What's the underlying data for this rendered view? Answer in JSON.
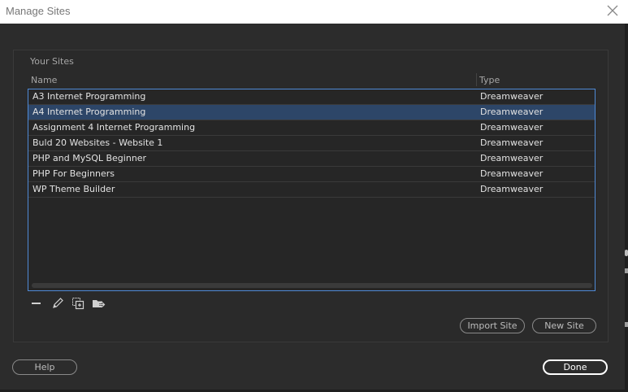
{
  "window": {
    "title": "Manage Sites"
  },
  "panel": {
    "section_label": "Your Sites",
    "columns": {
      "name": "Name",
      "type": "Type"
    },
    "sites": [
      {
        "name": "A3 Internet Programming",
        "type": "Dreamweaver"
      },
      {
        "name": "A4 Internet Programming",
        "type": "Dreamweaver",
        "selected": true
      },
      {
        "name": "Assignment 4 Internet Programming",
        "type": "Dreamweaver"
      },
      {
        "name": "Buld 20 Websites - Website 1",
        "type": "Dreamweaver"
      },
      {
        "name": "PHP and MySQL Beginner",
        "type": "Dreamweaver"
      },
      {
        "name": "PHP For Beginners",
        "type": "Dreamweaver"
      },
      {
        "name": "WP Theme Builder",
        "type": "Dreamweaver"
      }
    ],
    "toolbar_icons": [
      "minus-icon",
      "pencil-icon",
      "duplicate-icon",
      "export-icon"
    ]
  },
  "buttons": {
    "import_site": "Import Site",
    "new_site": "New Site",
    "help": "Help",
    "done": "Done"
  },
  "colors": {
    "selection": "#2d4668",
    "list_border": "#4f8ad6",
    "background": "#2c2c2c"
  }
}
